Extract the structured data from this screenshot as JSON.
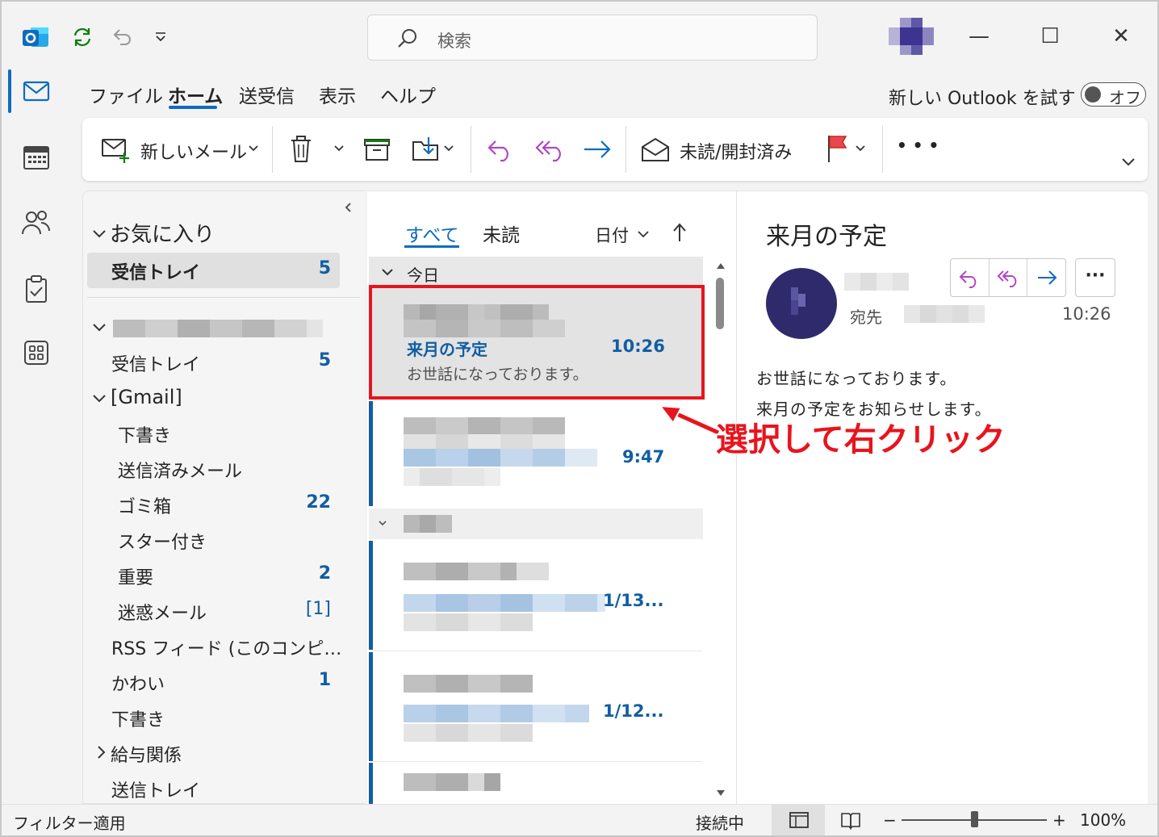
{
  "titlebar": {
    "search_placeholder": "検索",
    "minimize": "—",
    "maximize": "☐",
    "close": "✕"
  },
  "menu": {
    "file": "ファイル",
    "home": "ホーム",
    "send_receive": "送受信",
    "view": "表示",
    "help": "ヘルプ",
    "try_new": "新しい Outlook を試す",
    "toggle": "オフ"
  },
  "ribbon": {
    "new_mail": "新しいメール",
    "unread_read": "未読/開封済み",
    "more": "• • •"
  },
  "folders": {
    "favorites_label": "お気に入り",
    "fav_inbox": "受信トレイ",
    "fav_inbox_count": "5",
    "inbox": "受信トレイ",
    "inbox_count": "5",
    "gmail": "[Gmail]",
    "drafts": "下書き",
    "sent": "送信済みメール",
    "trash": "ゴミ箱",
    "trash_count": "22",
    "starred": "スター付き",
    "important": "重要",
    "important_count": "2",
    "spam": "迷惑メール",
    "spam_count": "[1]",
    "rss": "RSS フィード (このコンピ…",
    "kawai": "かわい",
    "kawai_count": "1",
    "drafts2": "下書き",
    "salary": "給与関係",
    "outbox": "送信トレイ"
  },
  "list": {
    "tab_all": "すべて",
    "tab_unread": "未読",
    "sort": "日付",
    "group_today": "今日",
    "msg1_subject": "来月の予定",
    "msg1_time": "10:26",
    "msg1_preview": "お世話になっております。",
    "msg2_time": "9:47",
    "msg3_time": "1/13...",
    "msg4_time": "1/12..."
  },
  "reading": {
    "subject": "来月の予定",
    "to_label": "宛先",
    "time": "10:26",
    "more": "···",
    "body_line1": "お世話になっております。",
    "body_line2": "来月の予定をお知らせします。"
  },
  "annotation": "選択して右クリック",
  "status": {
    "filter": "フィルター適用",
    "connected": "接続中",
    "zoom_minus": "−",
    "zoom_plus": "+",
    "zoom": "100%"
  },
  "colors": {
    "accent": "#0f6cbd",
    "highlight_red": "#e8141d",
    "reply_purple": "#b146c2"
  }
}
